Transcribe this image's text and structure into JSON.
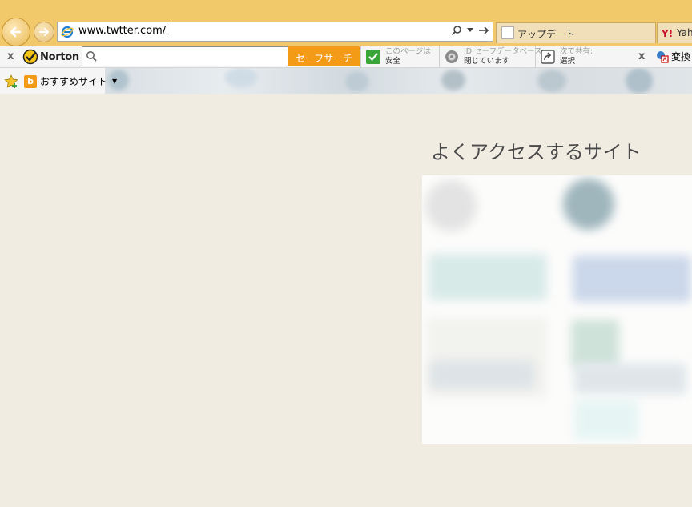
{
  "address_bar": {
    "url": "www.twtter.com/"
  },
  "tabs": [
    {
      "label": "アップデート"
    },
    {
      "label": "Yah"
    }
  ],
  "norton_toolbar": {
    "logo_text": "Norton",
    "search_placeholder": "",
    "search_button": "セーフサーチ",
    "page_status": {
      "line1": "このページは",
      "line2": "安全"
    },
    "identity_safe": {
      "line1": "ID セーフデータベース",
      "line2": "閉じています"
    },
    "share": {
      "line1": "次で共有:",
      "line2": "選択"
    },
    "convert_label": "変換"
  },
  "favorites_bar": {
    "suggested_sites": "おすすめサイト"
  },
  "content": {
    "frequent_sites_title": "よくアクセスするサイト"
  },
  "colors": {
    "title_band": "#f1c86a",
    "page_bg": "#f1ece2",
    "norton_accent": "#f39a17"
  }
}
